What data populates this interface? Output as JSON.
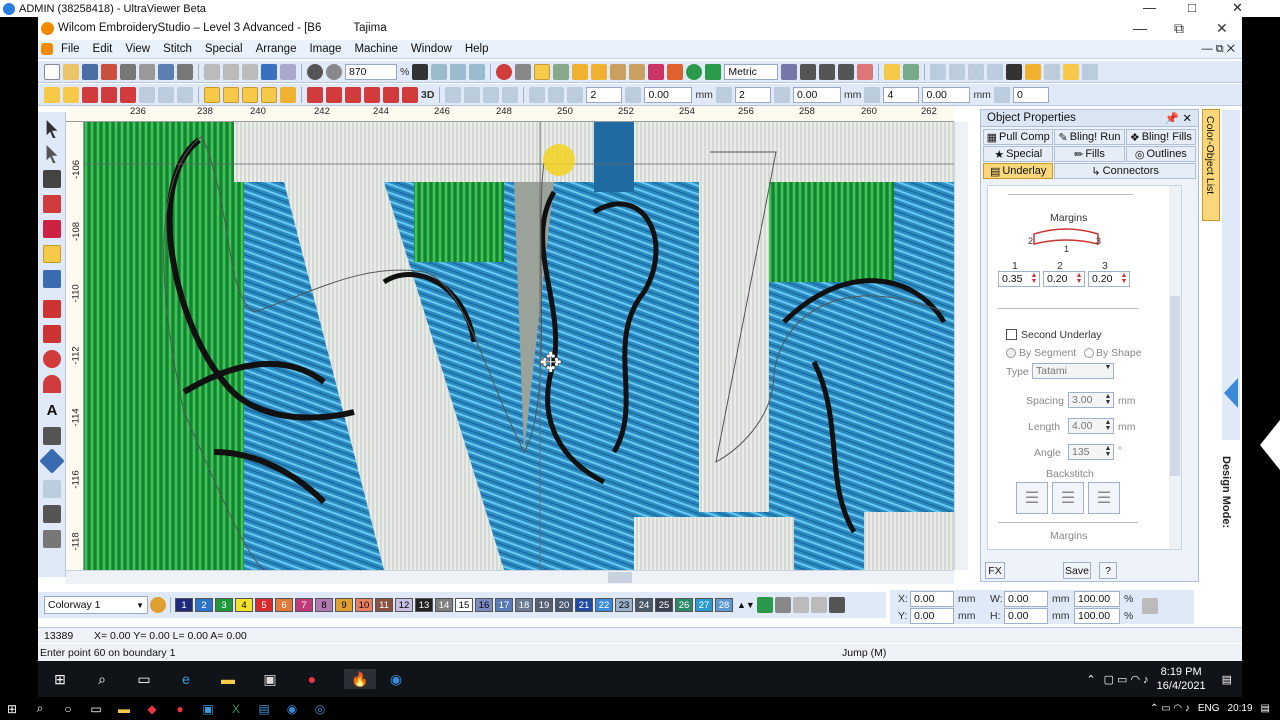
{
  "viewer": {
    "title": "ADMIN (38258418) - UltraViewer Beta",
    "minimize": "—",
    "maximize": "□",
    "close": "✕"
  },
  "app": {
    "title": "Wilcom EmbroideryStudio – Level 3 Advanced - [B6",
    "profile": "Tajima",
    "minimize": "—",
    "restore": "⧉",
    "close": "✕"
  },
  "menu": [
    "File",
    "Edit",
    "View",
    "Stitch",
    "Special",
    "Arrange",
    "Image",
    "Machine",
    "Window",
    "Help"
  ],
  "toolbar1": {
    "zoom": "870",
    "zoom_unit": "%",
    "units": "Metric"
  },
  "toolbar2": {
    "v1": "2",
    "v2": "0.00",
    "unit1": "mm",
    "v3": "2",
    "v4": "0.00",
    "unit2": "mm",
    "v5": "4",
    "v6": "0.00",
    "unit3": "mm",
    "v7": "0",
    "mode_3d": "3D"
  },
  "ruler_h": [
    "236",
    "238",
    "240",
    "242",
    "244",
    "246",
    "248",
    "250",
    "252",
    "254",
    "256",
    "258",
    "260",
    "262"
  ],
  "ruler_v": [
    "-106",
    "-108",
    "-110",
    "-112",
    "-114",
    "-116",
    "-118"
  ],
  "panel": {
    "title": "Object Properties",
    "tabs": [
      "Pull Comp",
      "Bling! Run",
      "Bling! Fills",
      "Special",
      "Fills",
      "Outlines",
      "Underlay",
      "Connectors"
    ],
    "margins_label": "Margins",
    "margin_cols": [
      "1",
      "2",
      "3"
    ],
    "margin_values": [
      "0.35",
      "0.20",
      "0.20"
    ],
    "shape_labels": [
      "2",
      "1",
      "3"
    ],
    "second_underlay": "Second Underlay",
    "by_segment": "By Segment",
    "by_shape": "By Shape",
    "type_label": "Type",
    "type_value": "Tatami",
    "spacing_label": "Spacing",
    "spacing_value": "3.00",
    "spacing_unit": "mm",
    "length_label": "Length",
    "length_value": "4.00",
    "length_unit": "mm",
    "angle_label": "Angle",
    "angle_value": "135",
    "angle_unit": "°",
    "backstitch_label": "Backstitch",
    "margins2_label": "Margins",
    "fx": "FX",
    "save": "Save",
    "help": "?"
  },
  "side_tab": "Color-Object List",
  "design_mode": "Design Mode:",
  "colorway": {
    "label": "Colorway 1",
    "chips": [
      {
        "n": "1",
        "c": "#1f2a7a",
        "t": "#fff"
      },
      {
        "n": "2",
        "c": "#2b74c9",
        "t": "#fff"
      },
      {
        "n": "3",
        "c": "#1f9a3b",
        "t": "#fff"
      },
      {
        "n": "4",
        "c": "#f2e22a",
        "t": "#000"
      },
      {
        "n": "5",
        "c": "#d92b2b",
        "t": "#fff"
      },
      {
        "n": "6",
        "c": "#e07a3a",
        "t": "#fff"
      },
      {
        "n": "7",
        "c": "#c23a7a",
        "t": "#fff"
      },
      {
        "n": "8",
        "c": "#b07ab0",
        "t": "#000"
      },
      {
        "n": "9",
        "c": "#e0a030",
        "t": "#000"
      },
      {
        "n": "10",
        "c": "#e88060",
        "t": "#000"
      },
      {
        "n": "11",
        "c": "#8a5040",
        "t": "#fff"
      },
      {
        "n": "12",
        "c": "#c8c0e0",
        "t": "#000"
      },
      {
        "n": "13",
        "c": "#222222",
        "t": "#fff"
      },
      {
        "n": "14",
        "c": "#808080",
        "t": "#fff"
      },
      {
        "n": "15",
        "c": "#ffffff",
        "t": "#000"
      },
      {
        "n": "16",
        "c": "#7a8ac0",
        "t": "#000"
      },
      {
        "n": "17",
        "c": "#5a7ab8",
        "t": "#fff"
      },
      {
        "n": "18",
        "c": "#6a7a90",
        "t": "#fff"
      },
      {
        "n": "19",
        "c": "#556070",
        "t": "#fff"
      },
      {
        "n": "20",
        "c": "#4a5a70",
        "t": "#fff"
      },
      {
        "n": "21",
        "c": "#1f4aa0",
        "t": "#fff"
      },
      {
        "n": "22",
        "c": "#3a8ad8",
        "t": "#fff"
      },
      {
        "n": "23",
        "c": "#9ab0c8",
        "t": "#000"
      },
      {
        "n": "24",
        "c": "#4a5a6a",
        "t": "#fff"
      },
      {
        "n": "25",
        "c": "#3a4050",
        "t": "#fff"
      },
      {
        "n": "26",
        "c": "#2a8a6a",
        "t": "#fff"
      },
      {
        "n": "27",
        "c": "#2a9ad0",
        "t": "#fff"
      },
      {
        "n": "28",
        "c": "#5a9ad0",
        "t": "#fff"
      }
    ]
  },
  "coords": {
    "x_label": "X:",
    "x": "0.00",
    "y_label": "Y:",
    "y": "0.00",
    "w_label": "W:",
    "w": "0.00",
    "h_label": "H:",
    "h": "0.00",
    "unit": "mm",
    "wp": "100.00",
    "hp": "100.00",
    "pct": "%"
  },
  "status": {
    "count": "13389",
    "xy": "X=  0.00 Y=  0.00 L=  0.00 A=  0.00",
    "prompt": "Enter point 60 on boundary 1",
    "jump": "Jump (M)"
  },
  "clock": {
    "time": "8:19 PM",
    "date": "16/4/2021"
  },
  "outer": {
    "lang": "ENG",
    "time": "20:19"
  }
}
